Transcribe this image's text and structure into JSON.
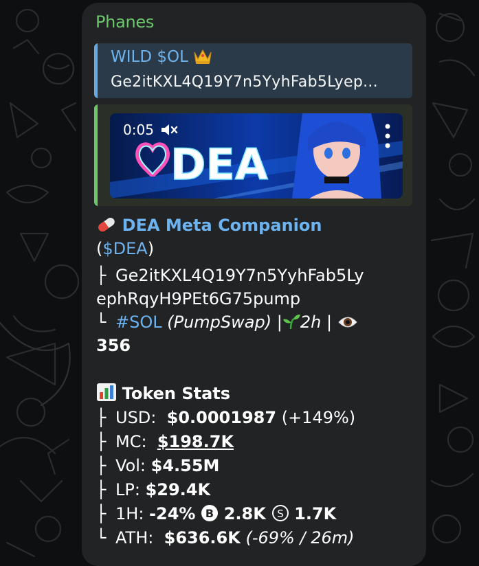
{
  "sender": "Phanes",
  "reply": {
    "title": "WILD $OL",
    "text": "Ge2itKXL4Q19Y7n5YyhFab5Lyep..."
  },
  "media": {
    "video_time": "0:05",
    "banner_text": "DEA"
  },
  "message": {
    "token_name": "DEA Meta Companion",
    "ticker_open": "(",
    "ticker": "$DEA",
    "ticker_close": ")",
    "address_line1": "Ge2itKXL4Q19Y7n5YyhFab5Ly",
    "address_line2": "ephRqyH9PEt6G75pump",
    "chain_tag": "#SOL",
    "dex": "(PumpSwap)",
    "sep1": "|",
    "age": "2h",
    "sep2": "|",
    "views": "356",
    "stats_title": "Token Stats",
    "stats": {
      "usd_label": "USD:",
      "usd_value": "$0.0001987",
      "usd_change": "(+149%)",
      "mc_label": "MC:",
      "mc_value": "$198.7K",
      "vol_label": "Vol:",
      "vol_value": "$4.55M",
      "lp_label": "LP:",
      "lp_value": "$29.4K",
      "h1_label": "1H:",
      "h1_change": "-24%",
      "h1_buys": "2.8K",
      "h1_sells": "1.7K",
      "ath_label": "ATH:",
      "ath_value": "$636.6K",
      "ath_detail": "(-69% / 26m)"
    }
  },
  "colors": {
    "sender_green": "#6bc76a",
    "link_blue": "#6cb3ef",
    "bubble_bg": "#212325",
    "reply_bg": "#2b3a48"
  }
}
